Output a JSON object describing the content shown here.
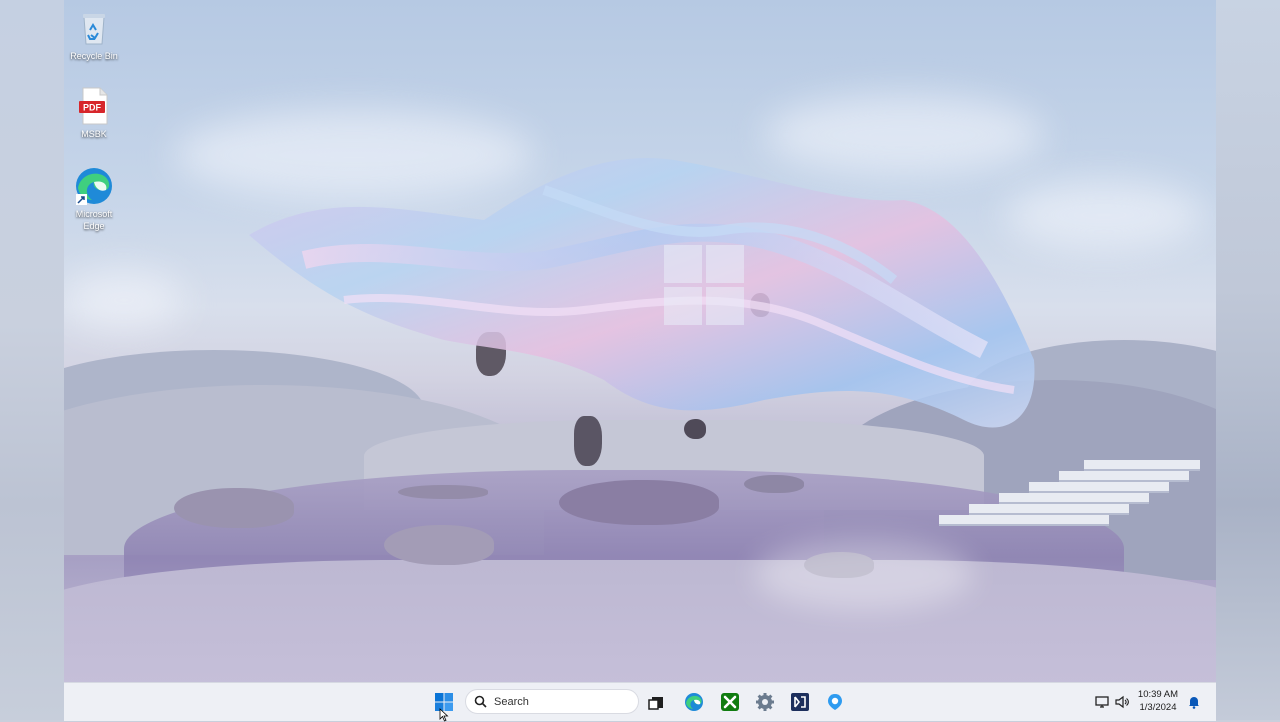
{
  "desktop": {
    "icons": [
      {
        "label": "Recycle Bin",
        "icon": "recycle-bin-icon"
      },
      {
        "label": "MSBK",
        "icon": "pdf-file-icon",
        "badge": "PDF"
      },
      {
        "label": "Microsoft Edge",
        "label_line1": "Microsoft",
        "label_line2": "Edge",
        "icon": "edge-icon"
      }
    ]
  },
  "taskbar": {
    "search_label": "Search",
    "apps": [
      "start-icon",
      "task-view-icon",
      "edge-icon",
      "xbox-icon",
      "settings-icon",
      "dell-icon",
      "copilot-icon"
    ],
    "tray": [
      "network-icon",
      "volume-icon",
      "notification-bell-icon"
    ],
    "time": "10:39 AM",
    "date": "1/3/2024"
  },
  "colors": {
    "accent": "#0067c0",
    "taskbar_bg": "#eef0f5",
    "pdf_red": "#d7262b"
  }
}
